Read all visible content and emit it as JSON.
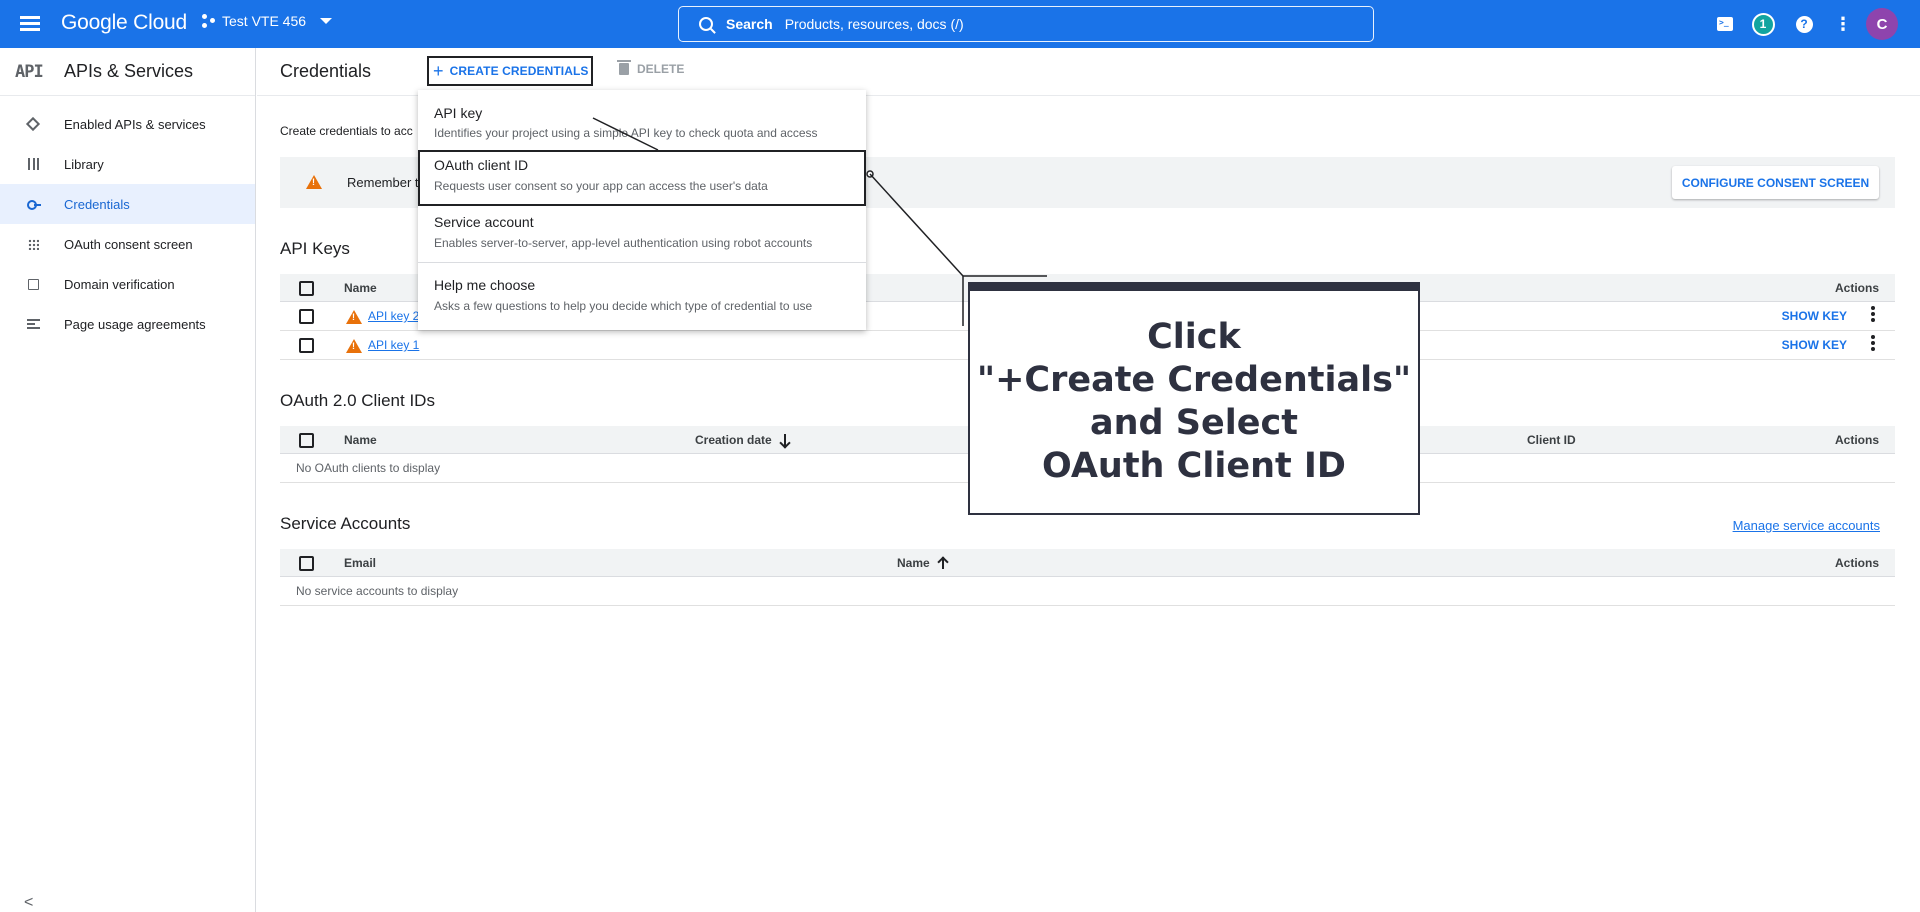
{
  "topbar": {
    "logo": "Google Cloud",
    "project": "Test VTE 456",
    "search_label": "Search",
    "search_placeholder": "Products, resources, docs (/)",
    "notification_count": "1",
    "avatar_letter": "C"
  },
  "sidebar": {
    "api_badge": "API",
    "title": "APIs & Services",
    "items": [
      {
        "label": "Enabled APIs & services",
        "icon": "apis-icon"
      },
      {
        "label": "Library",
        "icon": "library-icon"
      },
      {
        "label": "Credentials",
        "icon": "key-icon",
        "active": true
      },
      {
        "label": "OAuth consent screen",
        "icon": "consent-icon"
      },
      {
        "label": "Domain verification",
        "icon": "domain-check-icon"
      },
      {
        "label": "Page usage agreements",
        "icon": "agreements-icon"
      }
    ],
    "collapse_glyph": "<"
  },
  "header": {
    "title": "Credentials",
    "create_label": "CREATE CREDENTIALS",
    "delete_label": "DELETE"
  },
  "main": {
    "intro": "Create credentials to acc",
    "banner_text": "Remember t",
    "configure_label": "CONFIGURE CONSENT SCREEN",
    "api_keys": {
      "title": "API Keys",
      "columns": {
        "name": "Name",
        "actions": "Actions"
      },
      "rows": [
        {
          "name": "API key 2",
          "action": "SHOW KEY"
        },
        {
          "name": "API key 1",
          "action": "SHOW KEY"
        }
      ]
    },
    "oauth": {
      "title": "OAuth 2.0 Client IDs",
      "columns": {
        "name": "Name",
        "creation_date": "Creation date",
        "client_id": "Client ID",
        "actions": "Actions"
      },
      "empty": "No OAuth clients to display"
    },
    "service_accounts": {
      "title": "Service Accounts",
      "manage_link": "Manage service accounts",
      "columns": {
        "email": "Email",
        "name": "Name",
        "actions": "Actions"
      },
      "empty": "No service accounts to display"
    }
  },
  "dropdown": {
    "items": [
      {
        "title": "API key",
        "desc": "Identifies your project using a simple API key to check quota and access"
      },
      {
        "title": "OAuth client ID",
        "desc": "Requests user consent so your app can access the user's data"
      },
      {
        "title": "Service account",
        "desc": "Enables server-to-server, app-level authentication using robot accounts"
      },
      {
        "title": "Help me choose",
        "desc": "Asks a few questions to help you decide which type of credential to use"
      }
    ]
  },
  "callout": {
    "line1": "Click",
    "line2": "\"+Create Credentials\"",
    "line3": "and Select",
    "line4": "OAuth Client ID"
  },
  "colors": {
    "topbar": "#1a73e8",
    "accent": "#1a73e8",
    "active_bg": "#e8f0fe",
    "warning": "#e8710a",
    "callout": "#2e3140"
  }
}
